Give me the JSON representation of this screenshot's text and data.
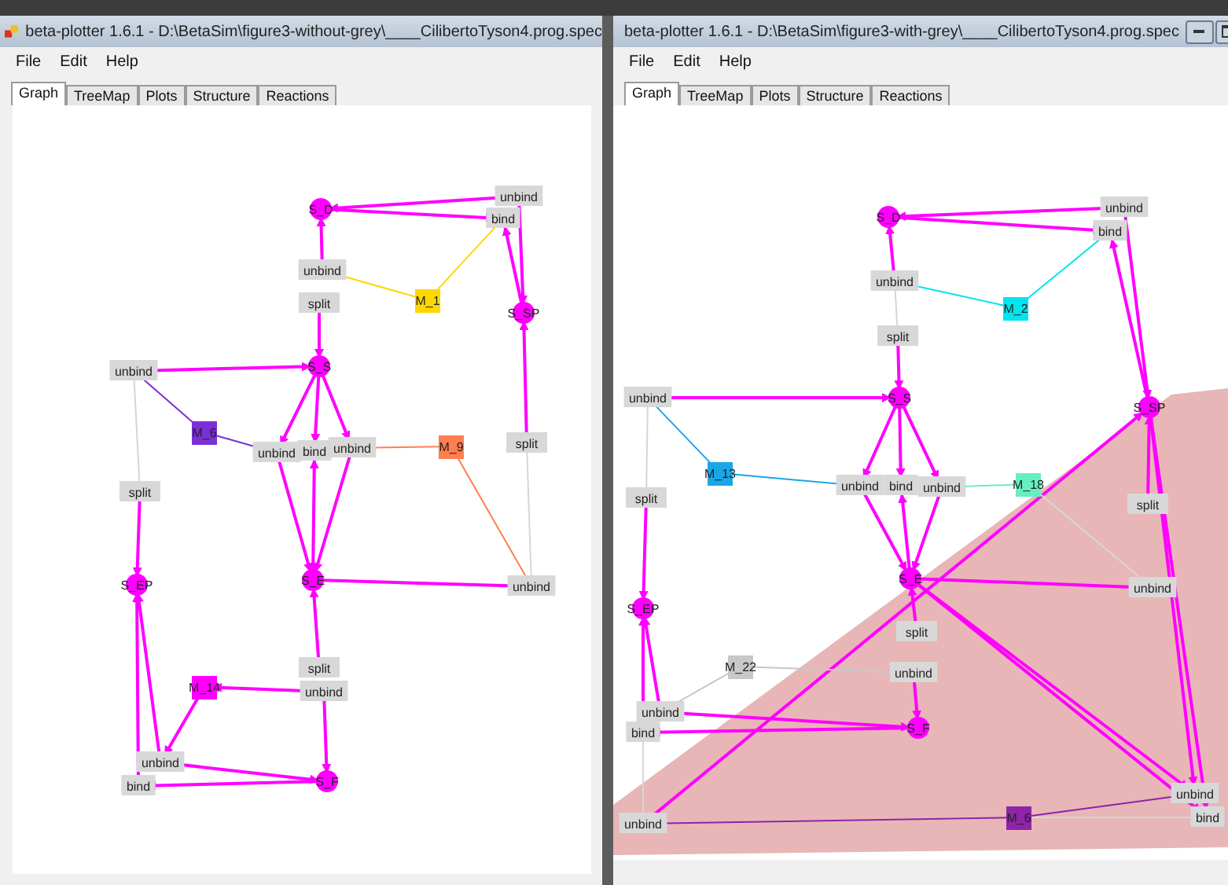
{
  "windows": [
    {
      "title": "beta-plotter 1.6.1 - D:\\BetaSim\\figure3-without-grey\\____CilibertoTyson4.prog.spec",
      "menu": [
        "File",
        "Edit",
        "Help"
      ],
      "tabs": [
        {
          "label": "Graph",
          "selected": true
        },
        {
          "label": "TreeMap",
          "selected": false
        },
        {
          "label": "Plots",
          "selected": false
        },
        {
          "label": "Structure",
          "selected": false
        },
        {
          "label": "Reactions",
          "selected": false
        }
      ],
      "graph": {
        "nodes": [
          {
            "label": "S_D",
            "kind": "species"
          },
          {
            "label": "unbind",
            "kind": "reaction"
          },
          {
            "label": "bind",
            "kind": "reaction"
          },
          {
            "label": "unbind",
            "kind": "reaction"
          },
          {
            "label": "M_1",
            "kind": "modifier",
            "color": "#ffd700"
          },
          {
            "label": "S_SP",
            "kind": "species"
          },
          {
            "label": "split",
            "kind": "reaction"
          },
          {
            "label": "S_S",
            "kind": "species"
          },
          {
            "label": "unbind",
            "kind": "reaction"
          },
          {
            "label": "M_6",
            "kind": "modifier",
            "color": "#7b2fd6"
          },
          {
            "label": "unbind",
            "kind": "reaction"
          },
          {
            "label": "bind",
            "kind": "reaction"
          },
          {
            "label": "unbind",
            "kind": "reaction"
          },
          {
            "label": "M_9",
            "kind": "modifier",
            "color": "#ff7f50"
          },
          {
            "label": "split",
            "kind": "reaction"
          },
          {
            "label": "split",
            "kind": "reaction"
          },
          {
            "label": "S_EP",
            "kind": "species"
          },
          {
            "label": "S_E",
            "kind": "species"
          },
          {
            "label": "unbind",
            "kind": "reaction"
          },
          {
            "label": "split",
            "kind": "reaction"
          },
          {
            "label": "unbind",
            "kind": "reaction"
          },
          {
            "label": "M_14",
            "kind": "modifier",
            "color": "#ff00ff"
          },
          {
            "label": "unbind",
            "kind": "reaction"
          },
          {
            "label": "bind",
            "kind": "reaction"
          },
          {
            "label": "S_F",
            "kind": "species"
          }
        ]
      }
    },
    {
      "title": "beta-plotter 1.6.1 - D:\\BetaSim\\figure3-with-grey\\____CilibertoTyson4.prog.spec",
      "menu": [
        "File",
        "Edit",
        "Help"
      ],
      "tabs": [
        {
          "label": "Graph",
          "selected": true
        },
        {
          "label": "TreeMap",
          "selected": false
        },
        {
          "label": "Plots",
          "selected": false
        },
        {
          "label": "Structure",
          "selected": false
        },
        {
          "label": "Reactions",
          "selected": false
        }
      ],
      "graph": {
        "highlighted": true,
        "nodes": [
          {
            "label": "S_D",
            "kind": "species"
          },
          {
            "label": "unbind",
            "kind": "reaction"
          },
          {
            "label": "bind",
            "kind": "reaction"
          },
          {
            "label": "unbind",
            "kind": "reaction"
          },
          {
            "label": "M_2",
            "kind": "modifier",
            "color": "#00e5ee"
          },
          {
            "label": "split",
            "kind": "reaction"
          },
          {
            "label": "S_S",
            "kind": "species"
          },
          {
            "label": "unbind",
            "kind": "reaction"
          },
          {
            "label": "S_SP",
            "kind": "species"
          },
          {
            "label": "M_13",
            "kind": "modifier",
            "color": "#1aa7e8"
          },
          {
            "label": "unbind",
            "kind": "reaction"
          },
          {
            "label": "bind",
            "kind": "reaction"
          },
          {
            "label": "unbind",
            "kind": "reaction"
          },
          {
            "label": "M_18",
            "kind": "modifier",
            "color": "#66f0c0"
          },
          {
            "label": "split",
            "kind": "reaction"
          },
          {
            "label": "split",
            "kind": "reaction"
          },
          {
            "label": "S_EP",
            "kind": "species"
          },
          {
            "label": "S_E",
            "kind": "species"
          },
          {
            "label": "unbind",
            "kind": "reaction"
          },
          {
            "label": "split",
            "kind": "reaction"
          },
          {
            "label": "M_22",
            "kind": "modifier",
            "color": "#c8c8c8"
          },
          {
            "label": "unbind",
            "kind": "reaction"
          },
          {
            "label": "unbind",
            "kind": "reaction"
          },
          {
            "label": "bind",
            "kind": "reaction"
          },
          {
            "label": "S_F",
            "kind": "species"
          },
          {
            "label": "unbind",
            "kind": "reaction"
          },
          {
            "label": "bind",
            "kind": "reaction"
          },
          {
            "label": "unbind",
            "kind": "reaction"
          },
          {
            "label": "M_6",
            "kind": "modifier",
            "color": "#8e24aa"
          }
        ]
      }
    }
  ]
}
